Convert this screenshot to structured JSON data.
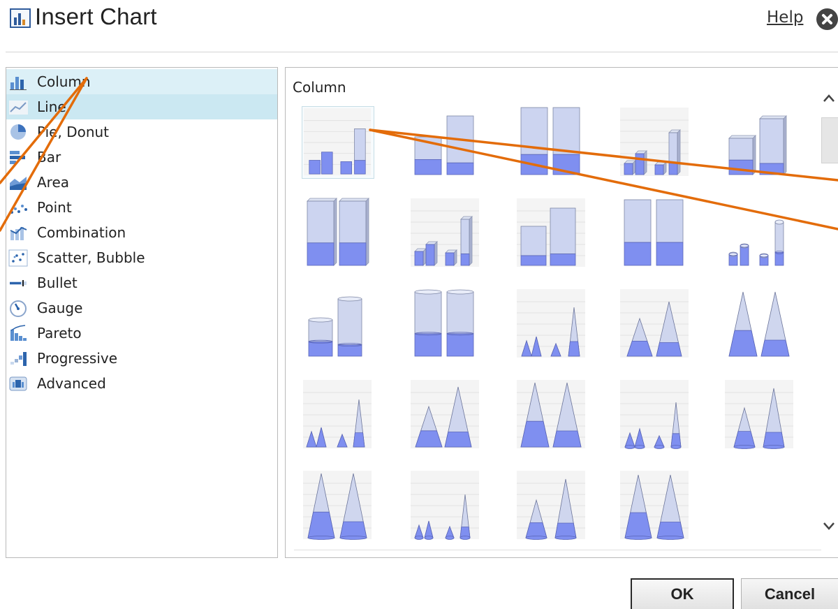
{
  "dialog": {
    "title": "Insert Chart",
    "help_label": "Help",
    "close_icon": "close-circle-icon",
    "ok_label": "OK",
    "cancel_label": "Cancel"
  },
  "categories": [
    {
      "label": "Column",
      "icon": "column-chart-icon",
      "state": "selected"
    },
    {
      "label": "Line",
      "icon": "line-chart-icon",
      "state": "hover"
    },
    {
      "label": "Pie, Donut",
      "icon": "pie-chart-icon",
      "state": ""
    },
    {
      "label": "Bar",
      "icon": "bar-chart-icon",
      "state": ""
    },
    {
      "label": "Area",
      "icon": "area-chart-icon",
      "state": ""
    },
    {
      "label": "Point",
      "icon": "point-chart-icon",
      "state": ""
    },
    {
      "label": "Combination",
      "icon": "combination-chart-icon",
      "state": ""
    },
    {
      "label": "Scatter, Bubble",
      "icon": "scatter-chart-icon",
      "state": ""
    },
    {
      "label": "Bullet",
      "icon": "bullet-chart-icon",
      "state": ""
    },
    {
      "label": "Gauge",
      "icon": "gauge-chart-icon",
      "state": ""
    },
    {
      "label": "Pareto",
      "icon": "pareto-chart-icon",
      "state": ""
    },
    {
      "label": "Progressive",
      "icon": "progressive-chart-icon",
      "state": ""
    },
    {
      "label": "Advanced",
      "icon": "advanced-chart-icon",
      "state": ""
    }
  ],
  "gallery": {
    "heading": "Column",
    "thumbnails": [
      "column-clustered",
      "column-stacked",
      "column-100-percent-stacked",
      "column-3d-clustered",
      "column-3d-stacked",
      "column-3d-100-percent-stacked",
      "column-3d",
      "cylinder-clustered",
      "cylinder-stacked",
      "cylinder-100-percent-stacked",
      "cylinder-3d-clustered",
      "cylinder-3d-stacked",
      "pyramid-clustered",
      "pyramid-stacked",
      "pyramid-100-percent-stacked",
      "pyramid-3d-clustered",
      "pyramid-3d-stacked",
      "pyramid-3d-100-percent-stacked",
      "cone-clustered",
      "cone-stacked",
      "cone-100-percent-stacked",
      "cone-3d-clustered",
      "cone-3d-stacked",
      "cone-3d-100-percent-stacked"
    ],
    "selected_index": 0
  },
  "annotation_color": "#e36c0a"
}
